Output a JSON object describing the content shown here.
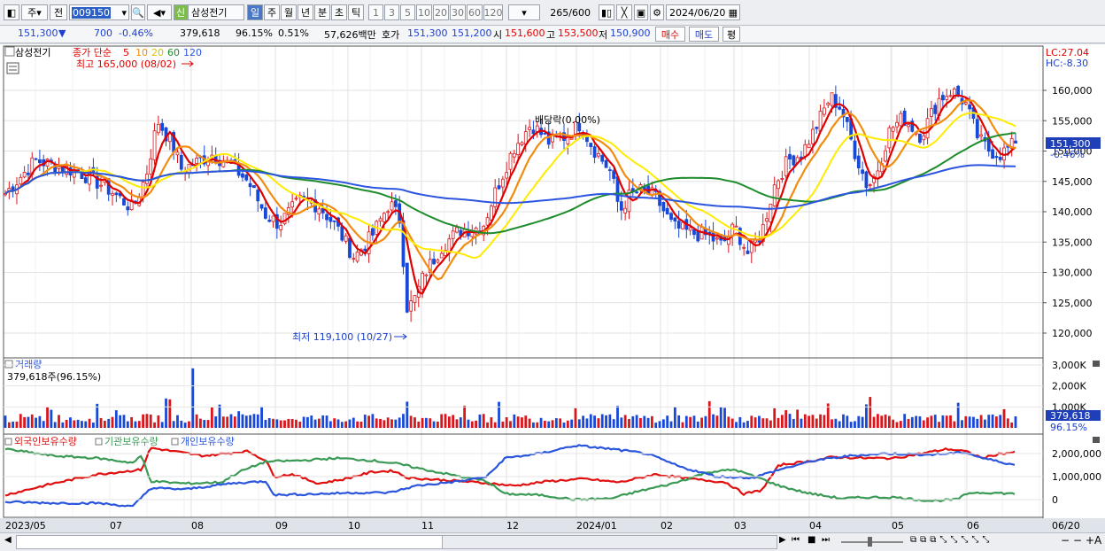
{
  "toolbar": {
    "period_type": "주",
    "nav_prev": "전",
    "stock_code": "009150",
    "stock_name": "삼성전기",
    "stock_badge": "신",
    "period_buttons": [
      "일",
      "주",
      "월",
      "년",
      "분",
      "초",
      "틱"
    ],
    "active_period": "일",
    "interval_buttons": [
      "1",
      "3",
      "5",
      "10",
      "20",
      "30",
      "60",
      "120"
    ],
    "count": "265",
    "count_total": "/600",
    "date": "2024/06/20"
  },
  "quote": {
    "price": "151,300",
    "change": "700",
    "change_pct": "-0.46%",
    "volume": "379,618",
    "volume_ratio": "96.15%",
    "turnover": "0.51%",
    "amount": "57,626백만",
    "ask_label": "호가",
    "ask1": "151,300",
    "ask2": "151,200",
    "open_label": "시",
    "open": "151,600",
    "high_label": "고",
    "high": "153,500",
    "low_label": "저",
    "low": "150,900",
    "buy_label": "매수",
    "sell_label": "매도",
    "eval_label": "평"
  },
  "price_pane": {
    "stock_tag": "삼성전기",
    "ma_label": "종가 단순",
    "ma_periods": [
      "5",
      "10",
      "20",
      "60",
      "120"
    ],
    "max_annotation": "최고 165,000 (08/02)",
    "min_annotation": "최저 119,100 (10/27)",
    "dividend_annotation": "배당락(0.00%)",
    "lc_label": "LC:27.04",
    "hc_label": "HC:-8.30",
    "price_ticks": [
      "160,000",
      "155,000",
      "150,000",
      "145,000",
      "140,000",
      "135,000",
      "130,000",
      "125,000",
      "120,000"
    ],
    "current_tag": "151,300",
    "current_pct": "-0.46%"
  },
  "volume_pane": {
    "title": "거래량",
    "current": "379,618주(96.15%)",
    "ticks": [
      "3,000K",
      "2,000K",
      "1,000K"
    ],
    "tag_value": "379,618",
    "tag_pct": "96.15%"
  },
  "holdings_pane": {
    "legend": [
      "외국인보유수량",
      "기관보유수량",
      "개인보유수량"
    ],
    "ticks": [
      "2,000,000",
      "1,000,000",
      "0"
    ]
  },
  "x_axis": [
    "2023/05",
    "07",
    "08",
    "09",
    "10",
    "11",
    "12",
    "2024/01",
    "02",
    "03",
    "04",
    "05",
    "06",
    "06/20"
  ],
  "colors": {
    "ma5": "#e00000",
    "ma10": "#f28c10",
    "ma20": "#ffeb00",
    "ma60": "#1e8c2c",
    "ma120": "#2b55e0",
    "up": "#d9161c",
    "down": "#1848d6",
    "foreign": "#e01010",
    "institution": "#3a9a55",
    "individual": "#2a55dd"
  }
}
